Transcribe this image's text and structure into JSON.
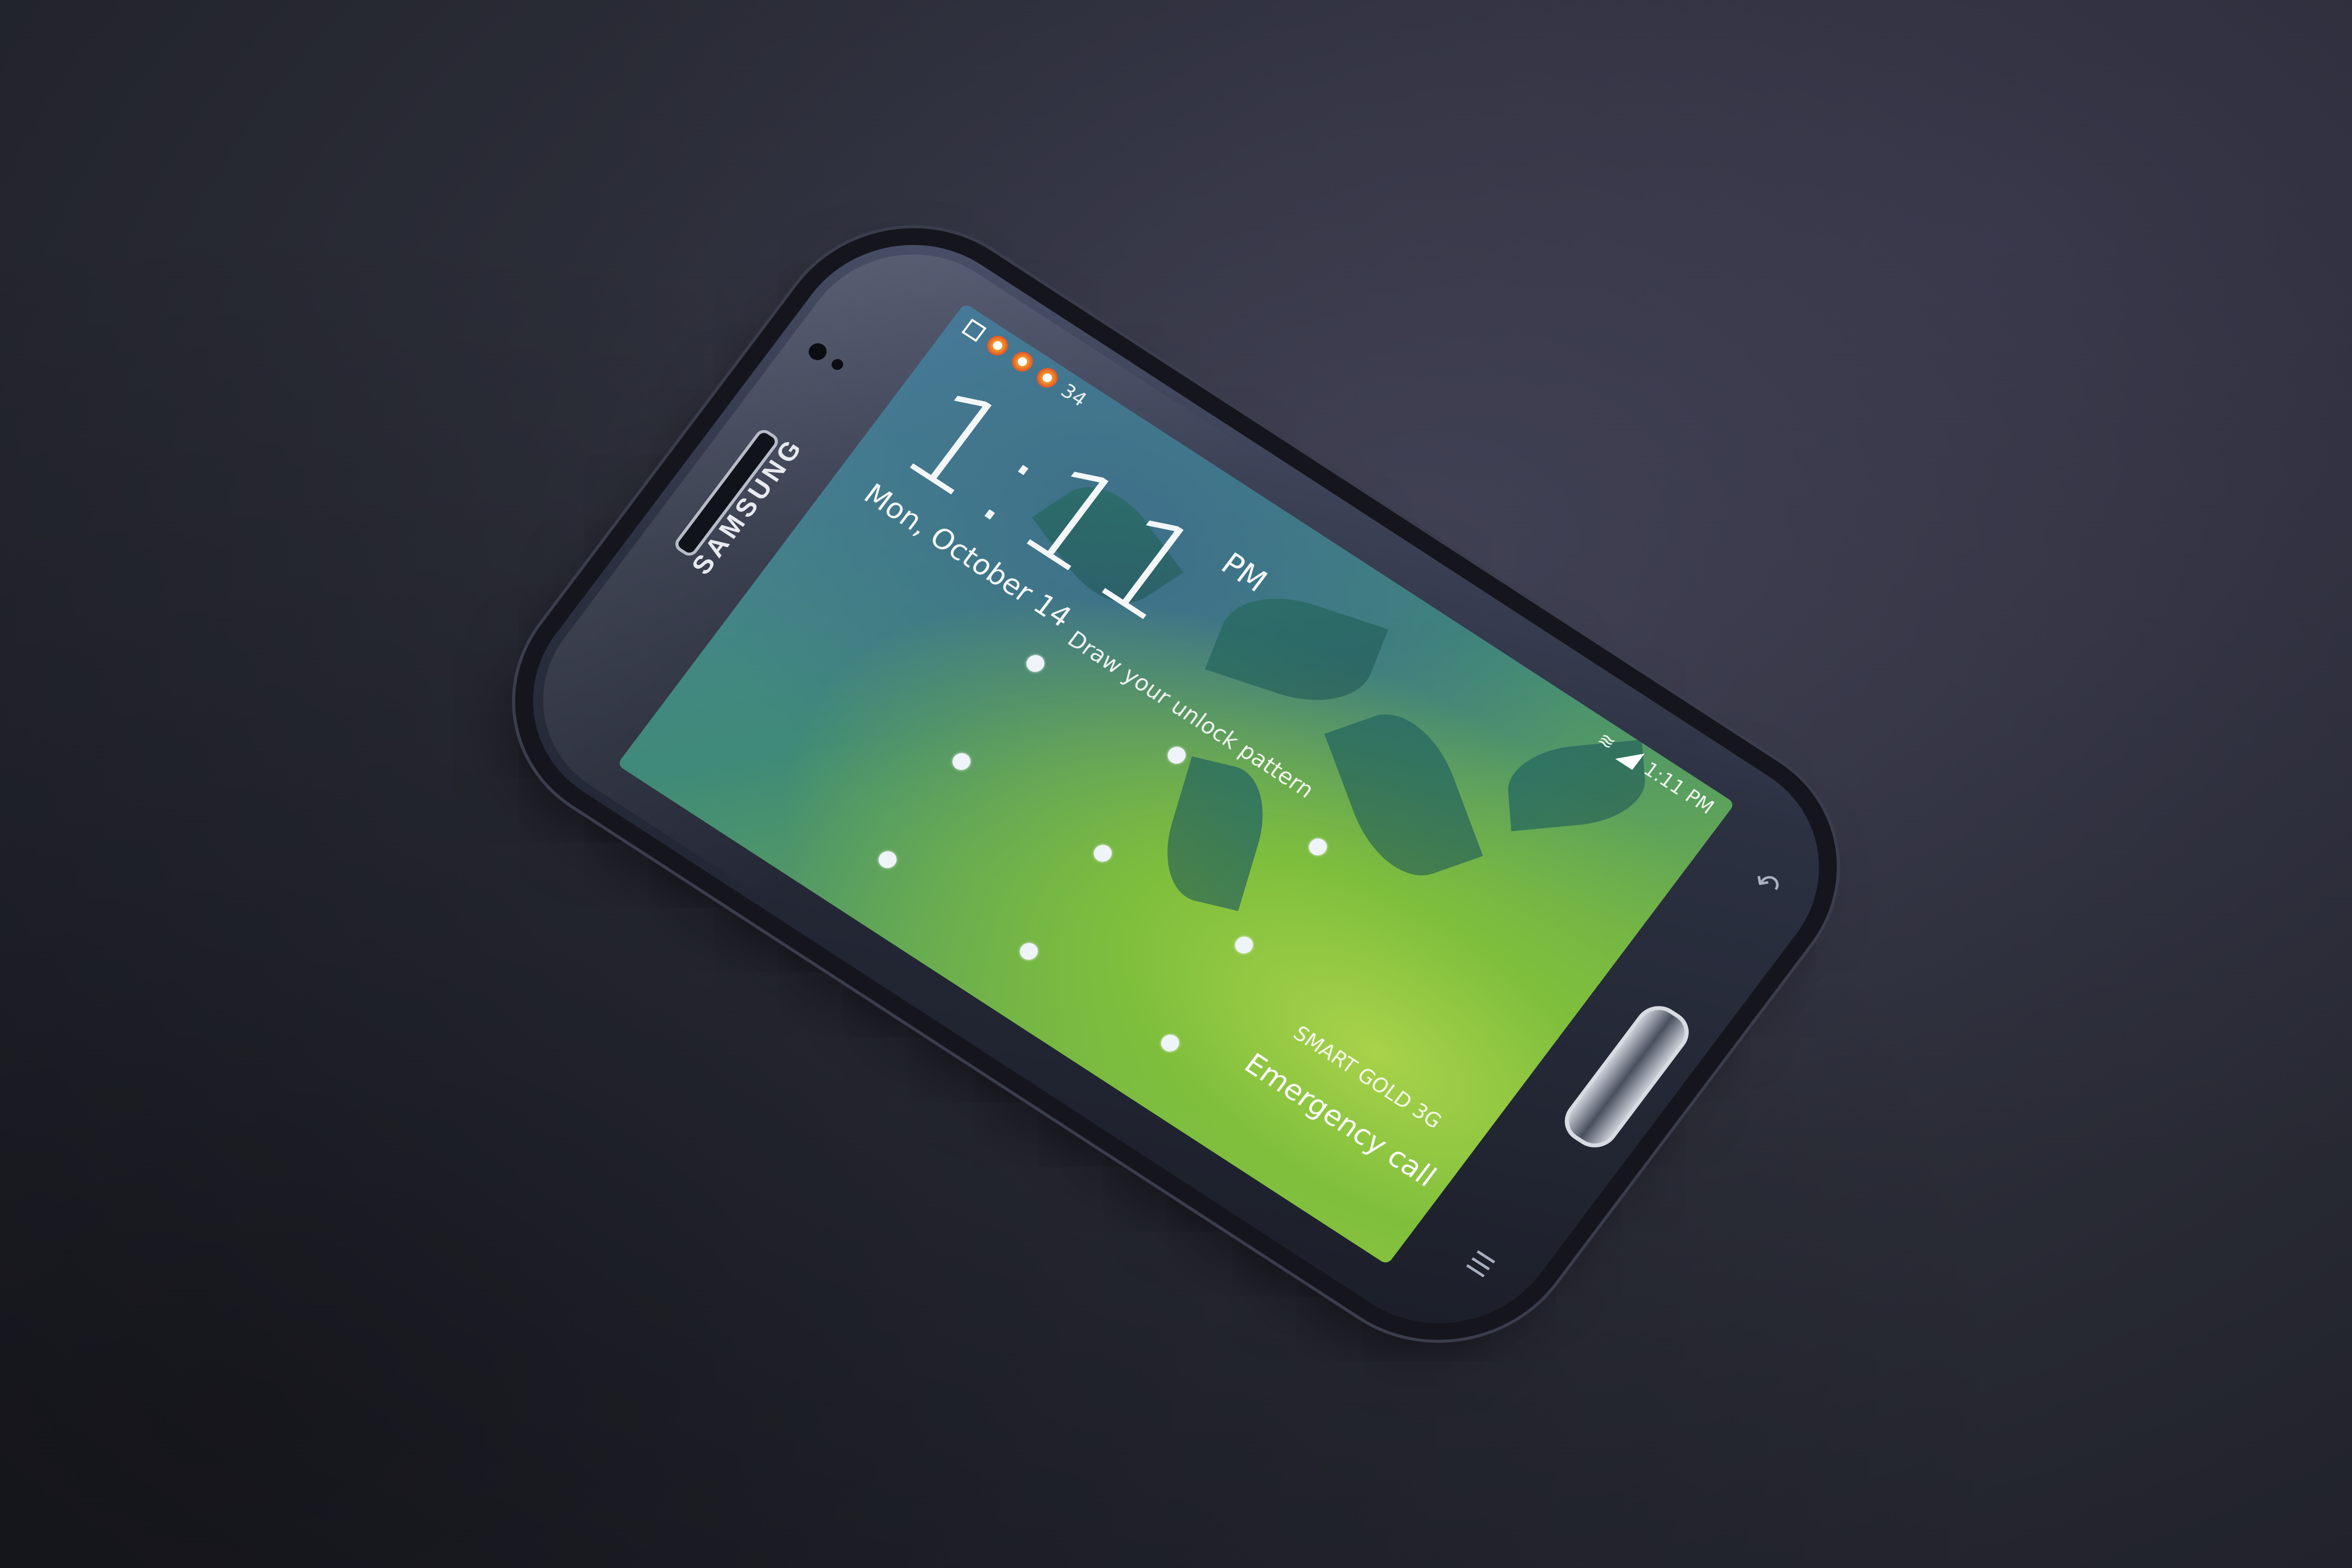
{
  "photo": {
    "subject": "Samsung phone lock screen",
    "brand_logo": "SAMSUNG"
  },
  "status_bar": {
    "notification_count": "34",
    "time": "1:11 PM"
  },
  "lock_screen": {
    "time": "1:11",
    "ampm": "PM",
    "date": "Mon, October 14",
    "unlock_prompt": "Draw your unlock pattern",
    "carrier": "SMART GOLD 3G",
    "emergency_call_label": "Emergency call"
  },
  "colors": {
    "wallpaper_green": "#7fbf3c",
    "wallpaper_teal": "#3f8a78",
    "phone_body": "#2c3142"
  },
  "icons": {
    "status_left": [
      "notification-square-icon",
      "chrome-notification-icon",
      "chrome-notification-icon",
      "chrome-notification-icon"
    ],
    "status_right": [
      "wifi-icon",
      "signal-icon"
    ],
    "keys": [
      "back-key-icon",
      "menu-key-icon"
    ]
  }
}
